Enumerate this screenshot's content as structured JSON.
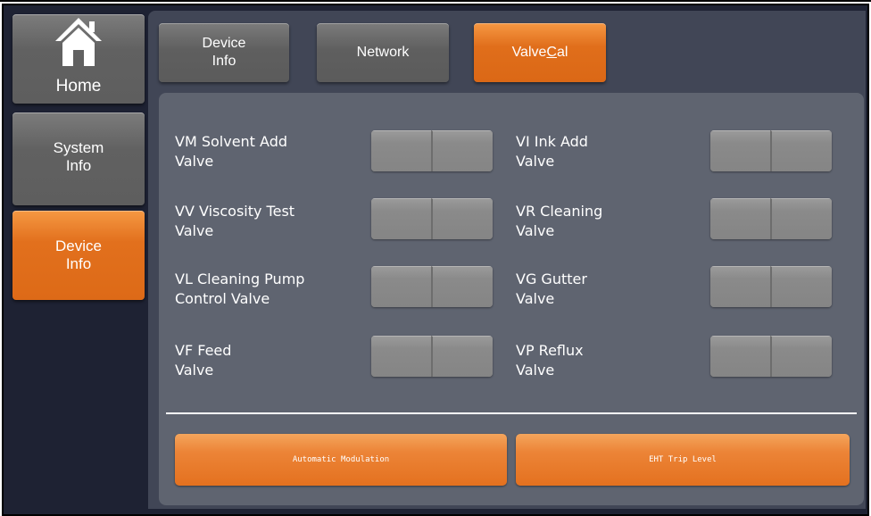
{
  "sidebar": {
    "home_label": "Home",
    "system_info_line1": "System",
    "system_info_line2": "Info",
    "device_info_line1": "Device",
    "device_info_line2": "Info",
    "active": "device-info"
  },
  "tabs": {
    "device_info_line1": "Device",
    "device_info_line2": "Info",
    "network": "Network",
    "valvecal_prefix": "Valve",
    "valvecal_underlined": "C",
    "valvecal_suffix": "al",
    "active": "valvecal"
  },
  "valves": {
    "left": [
      {
        "line1": "VM Solvent Add",
        "line2": "Valve"
      },
      {
        "line1": "VV Viscosity Test",
        "line2": "Valve"
      },
      {
        "line1": "VL Cleaning Pump",
        "line2": "Control Valve"
      },
      {
        "line1": "VF Feed",
        "line2": "Valve"
      }
    ],
    "right": [
      {
        "line1": "VI Ink Add",
        "line2": "Valve"
      },
      {
        "line1": "VR Cleaning",
        "line2": "Valve"
      },
      {
        "line1": "VG Gutter",
        "line2": "Valve"
      },
      {
        "line1": "VP Reflux",
        "line2": "Valve"
      }
    ]
  },
  "actions": {
    "automatic_modulation": "Automatic Modulation",
    "eht_trip_level": "EHT Trip Level"
  },
  "colors": {
    "accent_orange": "#e06e1b",
    "button_gray": "#5f5f5f",
    "background": "#1e2233",
    "panel": "#5f6470"
  },
  "icons": {
    "home": "house-icon"
  }
}
